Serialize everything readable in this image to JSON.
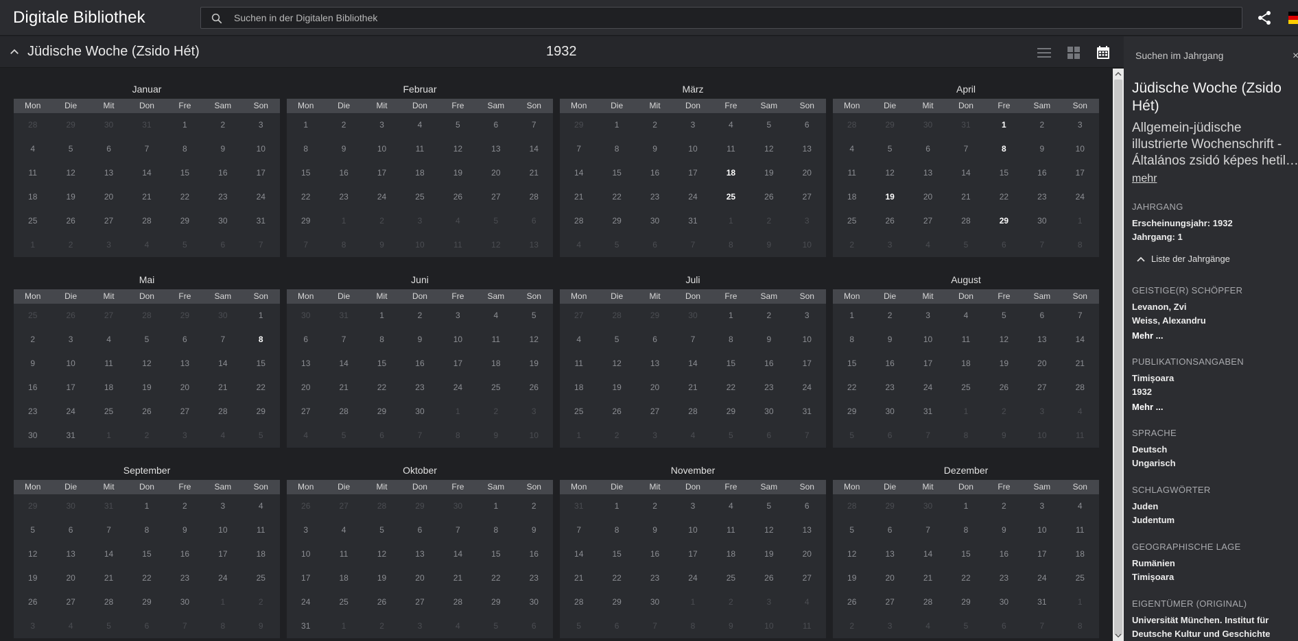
{
  "app": {
    "title": "Digitale Bibliothek"
  },
  "search": {
    "placeholder": "Suchen in der Digitalen Bibliothek"
  },
  "header": {
    "title": "Jüdische Woche (Zsido Hét)",
    "year": "1932"
  },
  "weekdays": [
    "Mon",
    "Die",
    "Mit",
    "Don",
    "Fre",
    "Sam",
    "Son"
  ],
  "months": [
    {
      "name": "Januar",
      "first_weekday": 4,
      "days": 31,
      "prev_days": 31,
      "issues": []
    },
    {
      "name": "Februar",
      "first_weekday": 0,
      "days": 29,
      "prev_days": 31,
      "issues": []
    },
    {
      "name": "März",
      "first_weekday": 1,
      "days": 31,
      "prev_days": 29,
      "issues": [
        18,
        25
      ]
    },
    {
      "name": "April",
      "first_weekday": 4,
      "days": 30,
      "prev_days": 31,
      "issues": [
        1,
        8,
        19,
        29
      ]
    },
    {
      "name": "Mai",
      "first_weekday": 6,
      "days": 31,
      "prev_days": 30,
      "issues": [
        8
      ]
    },
    {
      "name": "Juni",
      "first_weekday": 2,
      "days": 30,
      "prev_days": 31,
      "issues": []
    },
    {
      "name": "Juli",
      "first_weekday": 4,
      "days": 31,
      "prev_days": 30,
      "issues": []
    },
    {
      "name": "August",
      "first_weekday": 0,
      "days": 31,
      "prev_days": 31,
      "issues": []
    },
    {
      "name": "September",
      "first_weekday": 3,
      "days": 30,
      "prev_days": 31,
      "issues": []
    },
    {
      "name": "Oktober",
      "first_weekday": 5,
      "days": 31,
      "prev_days": 30,
      "issues": []
    },
    {
      "name": "November",
      "first_weekday": 1,
      "days": 30,
      "prev_days": 31,
      "issues": []
    },
    {
      "name": "Dezember",
      "first_weekday": 3,
      "days": 31,
      "prev_days": 30,
      "issues": []
    }
  ],
  "sidebar": {
    "search_label": "Suchen im Jahrgang",
    "close": "×",
    "title": "Jüdische Woche (Zsido Hét)",
    "subtitle": [
      "Allgemein-jüdische",
      "illustrierte Wochenschrift -",
      "Általános zsidó képes hetilap"
    ],
    "more": "mehr",
    "sections": {
      "jahrgang_label": "JAHRGANG",
      "jahrgang_lines": [
        "Erscheinungsjahr: 1932",
        "Jahrgang: 1"
      ],
      "volumes_link": "Liste der Jahrgänge",
      "creators_label": "GEISTIGE(R) SCHÖPFER",
      "creators": [
        "Levanon, Zvi",
        "Weiss, Alexandru"
      ],
      "creators_more": "Mehr ...",
      "publication_label": "PUBLIKATIONSANGABEN",
      "publication": [
        "Timișoara",
        "1932"
      ],
      "publication_more": "Mehr ...",
      "language_label": "SPRACHE",
      "languages": [
        "Deutsch",
        "Ungarisch"
      ],
      "keywords_label": "SCHLAGWÖRTER",
      "keywords": [
        "Juden",
        "Judentum"
      ],
      "geo_label": "GEOGRAPHISCHE LAGE",
      "geo": [
        "Rumänien",
        "Timișoara"
      ],
      "owner_label": "EIGENTÜMER (ORIGINAL)",
      "owner": [
        "Universität München. Institut für",
        "Deutsche Kultur und Geschichte"
      ]
    }
  },
  "colors": {
    "background": "#1f2023",
    "panel": "#2c2d31",
    "header_row": "#45474c",
    "issue_day": "#ffffff"
  }
}
